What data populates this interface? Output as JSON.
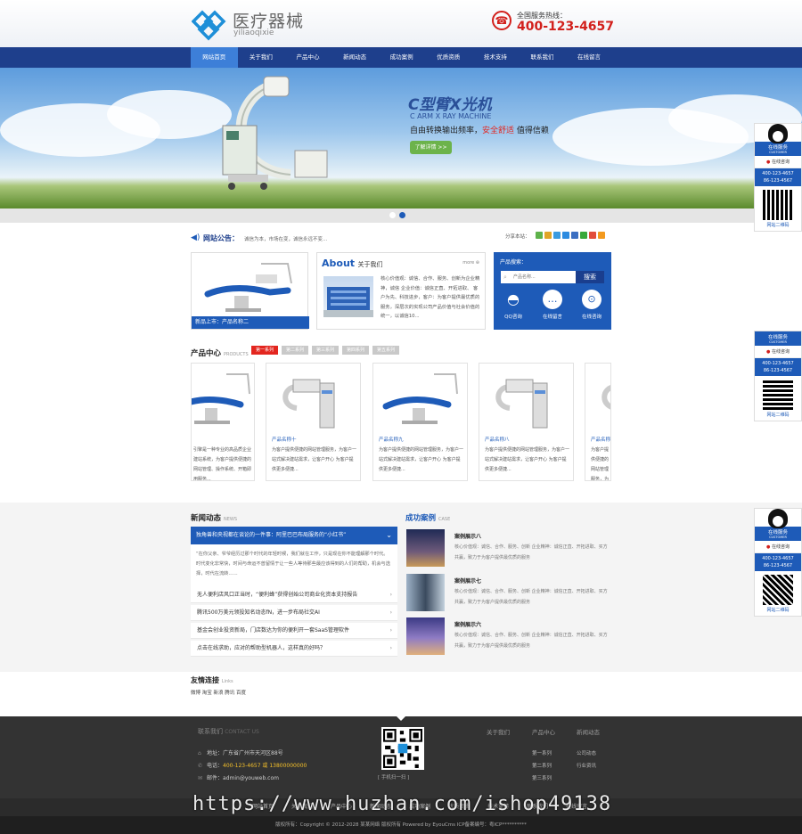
{
  "header": {
    "logo_cn": "医疗器械",
    "logo_en": "yiliaoqixie",
    "hotline_label": "全国服务热线：",
    "hotline_number": "400-123-4657"
  },
  "nav": {
    "items": [
      "网站首页",
      "关于我们",
      "产品中心",
      "新闻动态",
      "成功案例",
      "优质资质",
      "技术支持",
      "联系我们",
      "在线留言"
    ],
    "active_index": 0
  },
  "banner": {
    "title": "C型臂X光机",
    "subtitle": "C ARM X RAY MACHINE",
    "desc_before": "自由转换输出频率，",
    "desc_highlight": "安全舒适",
    "desc_after": " 值得信赖",
    "button": "了解详情 >>"
  },
  "notice": {
    "label": "网站公告：",
    "text": "诚信为本，市场在变，诚信永远不变..."
  },
  "share": {
    "label": "分享本站："
  },
  "feature": {
    "caption": "新品上市：产品名称二"
  },
  "about": {
    "title_en": "About",
    "title_cn": "关于我们",
    "more": "more",
    "text": "核心价值观：诚信、合作、服务、创新为企业精神，诚信 企业价值：诚信正直、开拓进取、 客户为先、科技进步，客户：为客户提供最优质的服务，深层次的实现公司产品价值与社会价值的统一，以诚信10..."
  },
  "search": {
    "title": "产品搜索：",
    "placeholder": "产品名称...",
    "button": "搜索",
    "items": [
      "QQ咨询",
      "在线留言",
      "在线咨询"
    ]
  },
  "products": {
    "title": "产品中心",
    "title_en": "PRODUCTS",
    "tabs": [
      "第一系列",
      "第二系列",
      "第三系列",
      "第四系列",
      "第五系列"
    ],
    "active_tab": 0,
    "cards": [
      {
        "name": "",
        "desc": "引擎是一种专业的高品质企业建站系统，为客户提供便捷的网站管理、操作系统、开箱即用服务..."
      },
      {
        "name": "产品名称十",
        "desc": "为客户提供便捷的网站管理服务，为客户一站式解决建站需求，让客户开心 为客户提供更多便捷..."
      },
      {
        "name": "产品名称九",
        "desc": "为客户提供便捷的网站管理服务，为客户一站式解决建站需求，让客户开心 为客户提供更多便捷..."
      },
      {
        "name": "产品名称八",
        "desc": "为客户提供便捷的网站管理服务，为客户一站式解决建站需求，让客户开心 为客户提供更多便捷..."
      },
      {
        "name": "产品名称七",
        "desc": "为客户提供便捷的网站管理服务，为客户一站式解决建站需求..."
      }
    ]
  },
  "news": {
    "title": "新闻动态",
    "title_en": "NEWS",
    "top_headline": "独角兽和央视都在谈论的一件事：阿里巴巴布局服务的“小红书”",
    "top_summary": "“在你父亲、爷爷经历过那个时代的年轻时候，我们就在工作，只是现在你不能理解那个时代。时代变化非常快，时间与命运不曾留情于让一些人等待那些最应该得到的人们的帮助，机会与选择，时代在流转……",
    "rows": [
      "无人便利店风口正当时，“便利蜂”获得创始公司商业化资本支持报告",
      "腾讯500万美元领投知名动态fN，进一步布局社交AI",
      "基金会创业投资新局，门店数达为你的便利开一套SaaS管理软件",
      "点击在线求助，应对的帮助型机器人，这样真的好吗？"
    ]
  },
  "cases": {
    "title": "成功案例",
    "title_en": "CASE",
    "items": [
      {
        "name": "案例展示八",
        "desc": "核心价值观：诚信、合作、服务、创新 企业精神：诚信正直、开拓进取、买方共赢，致力于为客户提供最优质的服务"
      },
      {
        "name": "案例展示七",
        "desc": "核心价值观：诚信、合作、服务、创新 企业精神：诚信正直、开拓进取、买方共赢，致力于为客户提供最优质的服务"
      },
      {
        "name": "案例展示六",
        "desc": "核心价值观：诚信、合作、服务、创新 企业精神：诚信正直、开拓进取、买方共赢，致力于为客户提供最优质的服务"
      }
    ]
  },
  "links": {
    "title": "友情连接",
    "title_en": "Links",
    "items": "微博 淘宝 新浪 腾讯 百度"
  },
  "footer": {
    "contact_title": "联系我们",
    "contact_en": "CONTACT US",
    "address_label": "地址：",
    "address": "广东省广州市天河区88号",
    "phone_label": "电话：",
    "phone": "400-123-4657 或 13800000000",
    "email_label": "邮件：",
    "email": "admin@youweb.com",
    "qr_caption": "[ 手机扫一扫 ]",
    "col1": {
      "title": "关于我们",
      "items": []
    },
    "col2": {
      "title": "产品中心",
      "items": [
        "第一系列",
        "第二系列",
        "第三系列"
      ]
    },
    "col3": {
      "title": "新闻动态",
      "items": [
        "公司动态",
        "行业资讯"
      ]
    },
    "nav": [
      "网站首页",
      "关于我们",
      "产品中心",
      "新闻动态",
      "成功案例",
      "优质资质",
      "技术支持",
      "联系我们",
      "在线留言"
    ],
    "copyright": "版权所有：Copyright © 2012-2028 某某网络 版权所有 Powered by EyouCms ICP备案编号：粤ICP**********"
  },
  "side": {
    "online": "在线服务",
    "customer": "CUSTOMER",
    "qq": "在线咨询",
    "tel1": "400-123-4657",
    "tel2": "86-123-4567",
    "qr_caption": "网站二维码"
  },
  "watermark": "https://www.huzhan.com/ishop49138",
  "colors": {
    "primary": "#1e5bb8",
    "nav": "#1e3f8c",
    "accent": "#e3261f",
    "green": "#6cb34b"
  }
}
